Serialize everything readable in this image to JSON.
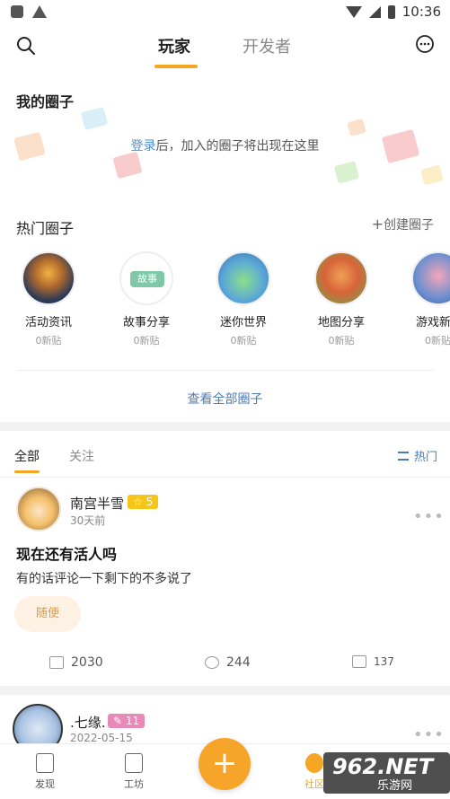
{
  "status_bar": {
    "time": "10:36"
  },
  "header": {
    "tabs": [
      {
        "label": "玩家"
      },
      {
        "label": "开发者"
      }
    ]
  },
  "my_circles": {
    "title": "我的圈子",
    "empty_link": "登录",
    "empty_text": "后，加入的圈子将出现在这里"
  },
  "hot_circles": {
    "title": "热门圈子",
    "create_label": "创建圈子",
    "items": [
      {
        "name": "活动资讯",
        "count": "0新贴",
        "color": "#2b3a57"
      },
      {
        "name": "故事分享",
        "count": "0新贴",
        "color": "#7ec8a8"
      },
      {
        "name": "迷你世界",
        "count": "0新贴",
        "color": "#5aa7d8"
      },
      {
        "name": "地图分享",
        "count": "0新贴",
        "color": "#d8643a"
      },
      {
        "name": "游戏新",
        "count": "0新贴",
        "color": "#6b8fd0"
      }
    ],
    "story_badge": "故事"
  },
  "view_all_label": "查看全部圈子",
  "feed": {
    "tabs": [
      {
        "label": "全部"
      },
      {
        "label": "关注"
      }
    ],
    "sort_label": "热门"
  },
  "posts": [
    {
      "username": "南宫半雪",
      "level": "5",
      "time": "30天前",
      "title": "现在还有活人吗",
      "body": "有的话评论一下剩下的不多说了",
      "tag": "随便",
      "reads": "2030",
      "comments": "244",
      "likes": "137"
    },
    {
      "username": ".七缘.",
      "level": "11",
      "time": "2022-05-15"
    }
  ],
  "bottom_nav": {
    "items": [
      {
        "label": "发现"
      },
      {
        "label": "工坊"
      },
      {
        "label": "社区"
      }
    ],
    "fab_label": "+"
  },
  "watermark": {
    "main": "962.NET",
    "sub": "乐游网"
  },
  "colors": {
    "accent": "#f5a623",
    "link": "#4a8fd8",
    "level_gold": "#f5c518",
    "level_pink": "#e889b8"
  }
}
